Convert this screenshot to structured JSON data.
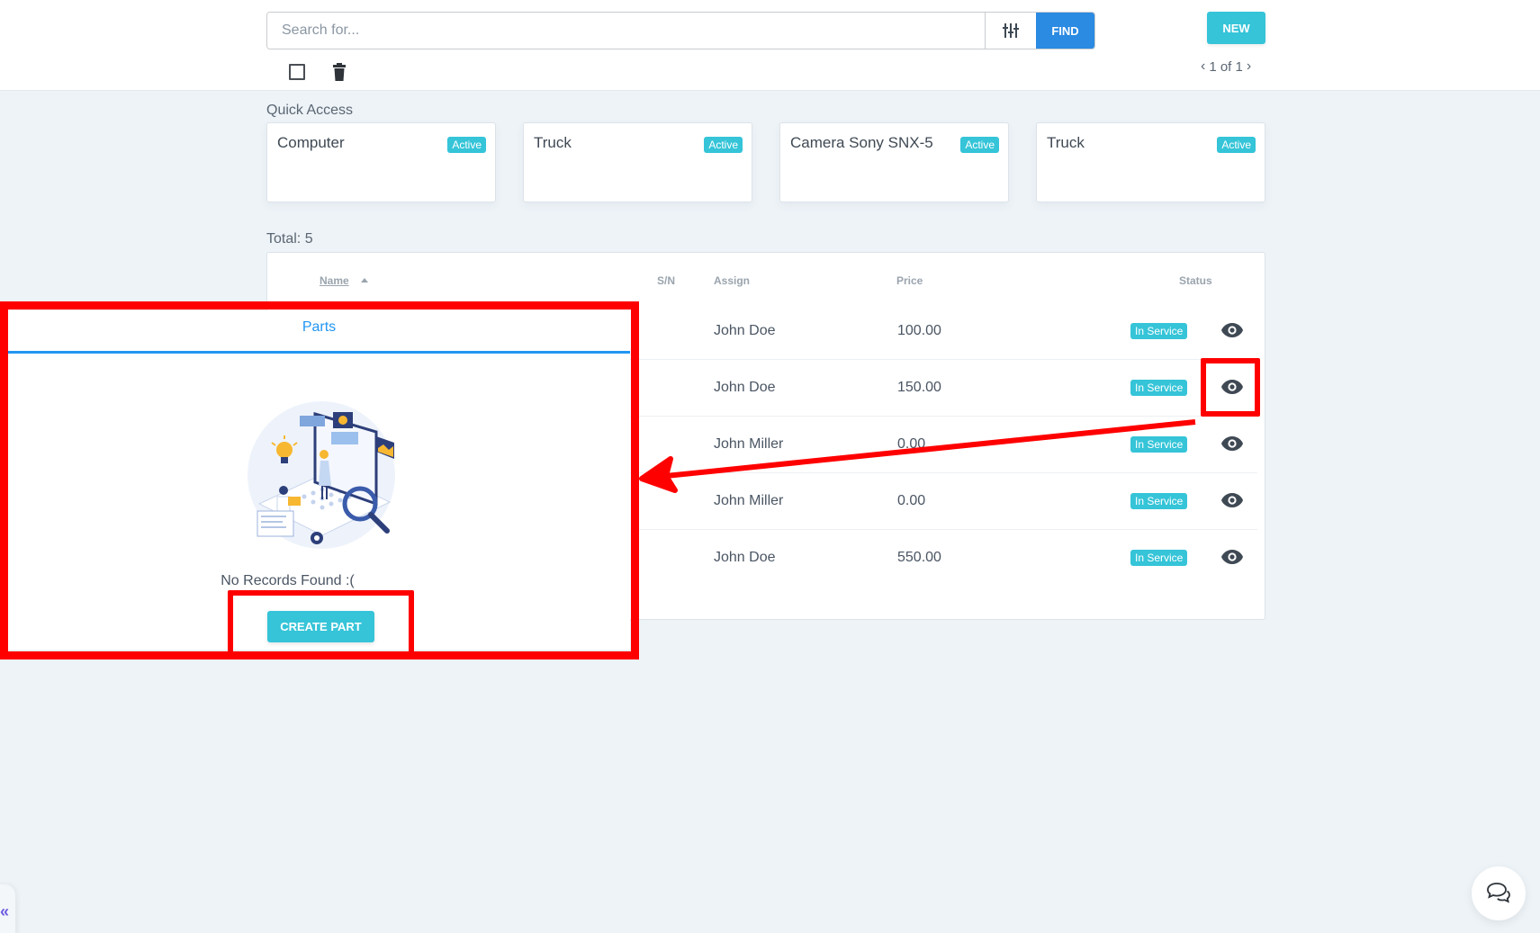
{
  "header": {
    "search": {
      "placeholder": "Search for...",
      "value": ""
    },
    "filter_icon": "sliders-icon",
    "find_label": "FIND",
    "new_label": "NEW",
    "pagination": {
      "prev": "‹",
      "text": "1 of 1",
      "next": "›"
    }
  },
  "quick_access": {
    "label": "Quick Access",
    "cards": [
      {
        "title": "Computer",
        "status": "Active"
      },
      {
        "title": "Truck",
        "status": "Active"
      },
      {
        "title": "Camera Sony SNX-5",
        "status": "Active"
      },
      {
        "title": "Truck",
        "status": "Active"
      }
    ]
  },
  "table": {
    "total": "Total: 5",
    "columns": {
      "name": "Name",
      "sn": "S/N",
      "assign": "Assign",
      "price": "Price",
      "status": "Status"
    },
    "rows": [
      {
        "assign": "John Doe",
        "price": "100.00",
        "status": "In Service"
      },
      {
        "assign": "John Doe",
        "price": "150.00",
        "status": "In Service"
      },
      {
        "assign": "John Miller",
        "price": "0.00",
        "status": "In Service"
      },
      {
        "assign": "John Miller",
        "price": "0.00",
        "status": "In Service"
      },
      {
        "assign": "John Doe",
        "price": "550.00",
        "status": "In Service"
      }
    ]
  },
  "panel": {
    "tab_label": "Parts",
    "empty_text": "No Records Found :(",
    "create_label": "CREATE PART"
  },
  "colors": {
    "primary_blue": "#2b8ae2",
    "accent_cyan": "#35c4d8",
    "tab_blue": "#2196f3",
    "annotation_red": "#ff0000"
  },
  "sidebar_toggle": "«"
}
